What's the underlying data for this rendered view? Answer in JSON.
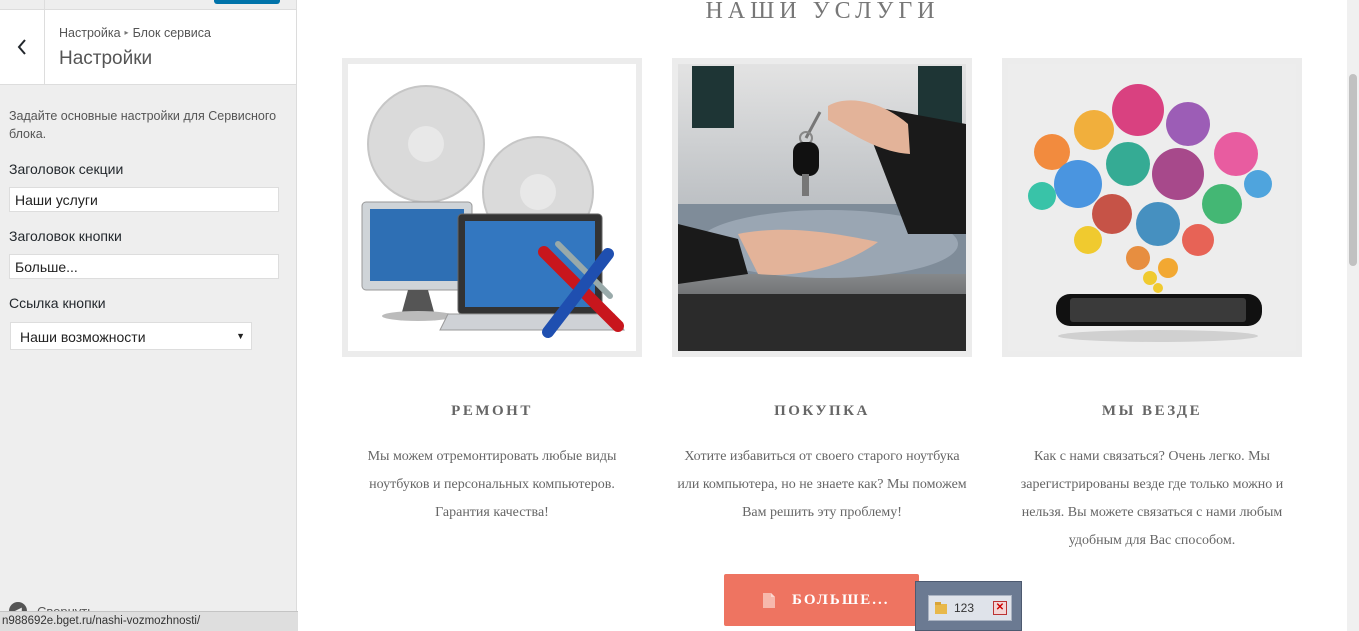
{
  "sidebar": {
    "breadcrumb": {
      "parent": "Настройка",
      "current": "Блок сервиса"
    },
    "panel_title": "Настройки",
    "description": "Задайте основные настройки для Сервисного блока.",
    "fields": {
      "section_title_label": "Заголовок секции",
      "section_title_value": "Наши услуги",
      "button_title_label": "Заголовок кнопки",
      "button_title_value": "Больше...",
      "button_link_label": "Ссылка кнопки",
      "button_link_value": "Наши возможности"
    },
    "collapse_label": "Свернуть"
  },
  "statusbar": {
    "url": "n988692e.bget.ru/nashi-vozmozhnosti/"
  },
  "preview": {
    "section_title": "НАШИ УСЛУГИ",
    "cards": [
      {
        "title": "РЕМОНТ",
        "text": "Мы можем отремонтировать любые виды ноутбуков и персональных компьютеров. Гарантия качества!"
      },
      {
        "title": "ПОКУПКА",
        "text": "Хотите избавиться от своего старого ноутбука или компьютера, но не знаете как? Мы поможем Вам решить эту проблему!"
      },
      {
        "title": "МЫ ВЕЗДЕ",
        "text": "Как с нами связаться? Очень легко. Мы зарегистрированы везде где только можно и нельзя. Вы можете связаться с нами любым удобным для Вас способом."
      }
    ],
    "more_button": "БОЛЬШЕ..."
  },
  "taskbar_popup": {
    "label": "123"
  },
  "colors": {
    "accent_button": "#ee7461",
    "wp_blue": "#0073aa",
    "sidebar_bg": "#eeeeee"
  },
  "icons": [
    "back-chevron-icon",
    "document-icon",
    "folder-icon",
    "close-icon",
    "collapse-icon",
    "dropdown-arrow-icon"
  ]
}
